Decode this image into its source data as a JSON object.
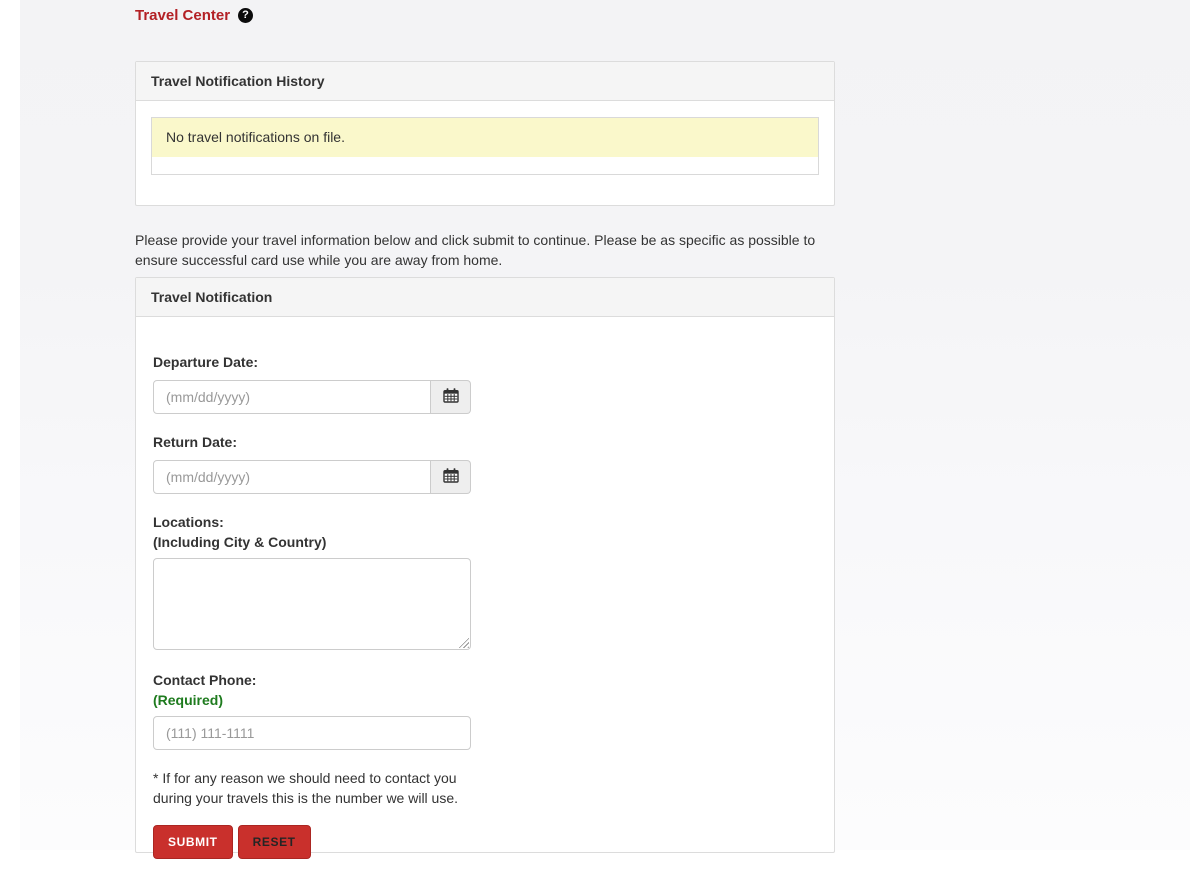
{
  "page": {
    "title": "Travel Center"
  },
  "icons": {
    "help_symbol": "?"
  },
  "history": {
    "header": "Travel Notification History",
    "empty_message": "No travel notifications on file."
  },
  "intro": "Please provide your travel information below and click submit to continue. Please be as specific as possible to ensure successful card use while you are away from home.",
  "form": {
    "header": "Travel Notification",
    "departure_label": "Departure Date:",
    "departure_placeholder": "(mm/dd/yyyy)",
    "departure_value": "",
    "return_label": "Return Date:",
    "return_placeholder": "(mm/dd/yyyy)",
    "return_value": "",
    "locations_label": "Locations:",
    "locations_sublabel": "(Including City & Country)",
    "locations_value": "",
    "phone_label": "Contact Phone:",
    "phone_required_note": "(Required)",
    "phone_placeholder": "(111) 111-1111",
    "phone_value": "",
    "phone_note": "* If for any reason we should need to contact you during your travels this is the number we will use.",
    "submit_label": "SUBMIT",
    "reset_label": "RESET"
  },
  "colors": {
    "title_red": "#b32025",
    "button_red": "#c9302c",
    "required_green": "#1e7b1e",
    "alert_yellow": "#faf8cb",
    "panel_header_bg": "#f5f5f5"
  }
}
